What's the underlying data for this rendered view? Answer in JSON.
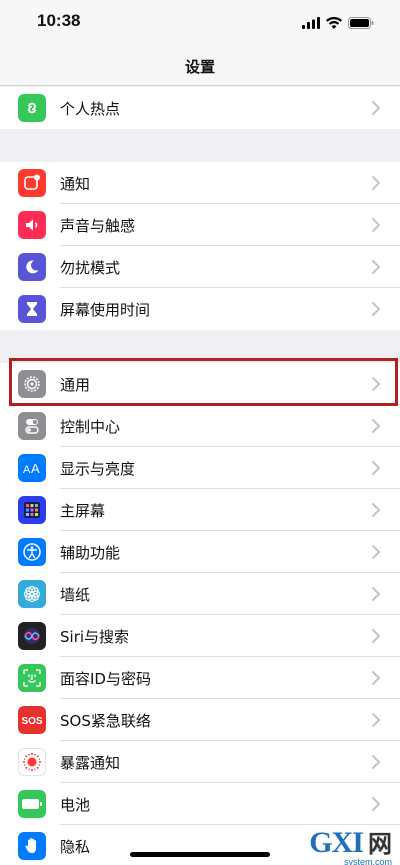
{
  "status_bar": {
    "time": "10:38"
  },
  "nav": {
    "title": "设置"
  },
  "groups": [
    [
      {
        "label": "个人热点",
        "icon": "personal-hotspot-icon",
        "color": "#34c759"
      }
    ],
    [
      {
        "label": "通知",
        "icon": "notifications-icon",
        "color": "#ff3b30"
      },
      {
        "label": "声音与触感",
        "icon": "sounds-icon",
        "color": "#ff2d55"
      },
      {
        "label": "勿扰模式",
        "icon": "do-not-disturb-icon",
        "color": "#5856d6"
      },
      {
        "label": "屏幕使用时间",
        "icon": "screen-time-icon",
        "color": "#5856d6"
      }
    ],
    [
      {
        "label": "通用",
        "icon": "general-gear-icon",
        "color": "#8e8e93"
      },
      {
        "label": "控制中心",
        "icon": "control-center-icon",
        "color": "#8e8e93"
      },
      {
        "label": "显示与亮度",
        "icon": "display-brightness-icon",
        "color": "#007aff"
      },
      {
        "label": "主屏幕",
        "icon": "home-screen-icon",
        "color": "#2b3ef0"
      },
      {
        "label": "辅助功能",
        "icon": "accessibility-icon",
        "color": "#007aff"
      },
      {
        "label": "墙纸",
        "icon": "wallpaper-icon",
        "color": "#35aadc"
      },
      {
        "label": "Siri与搜索",
        "icon": "siri-icon",
        "color": "#222222"
      },
      {
        "label": "面容ID与密码",
        "icon": "face-id-icon",
        "color": "#34c759"
      },
      {
        "label": "SOS紧急联络",
        "icon": "sos-icon",
        "color": "#e5322d"
      },
      {
        "label": "暴露通知",
        "icon": "exposure-notification-icon",
        "color": "#ffffff"
      },
      {
        "label": "电池",
        "icon": "battery-icon",
        "color": "#34c759"
      },
      {
        "label": "隐私",
        "icon": "privacy-hand-icon",
        "color": "#007aff"
      }
    ]
  ],
  "watermark": {
    "logo": "GXI",
    "zh": "网",
    "site": "system.com"
  }
}
